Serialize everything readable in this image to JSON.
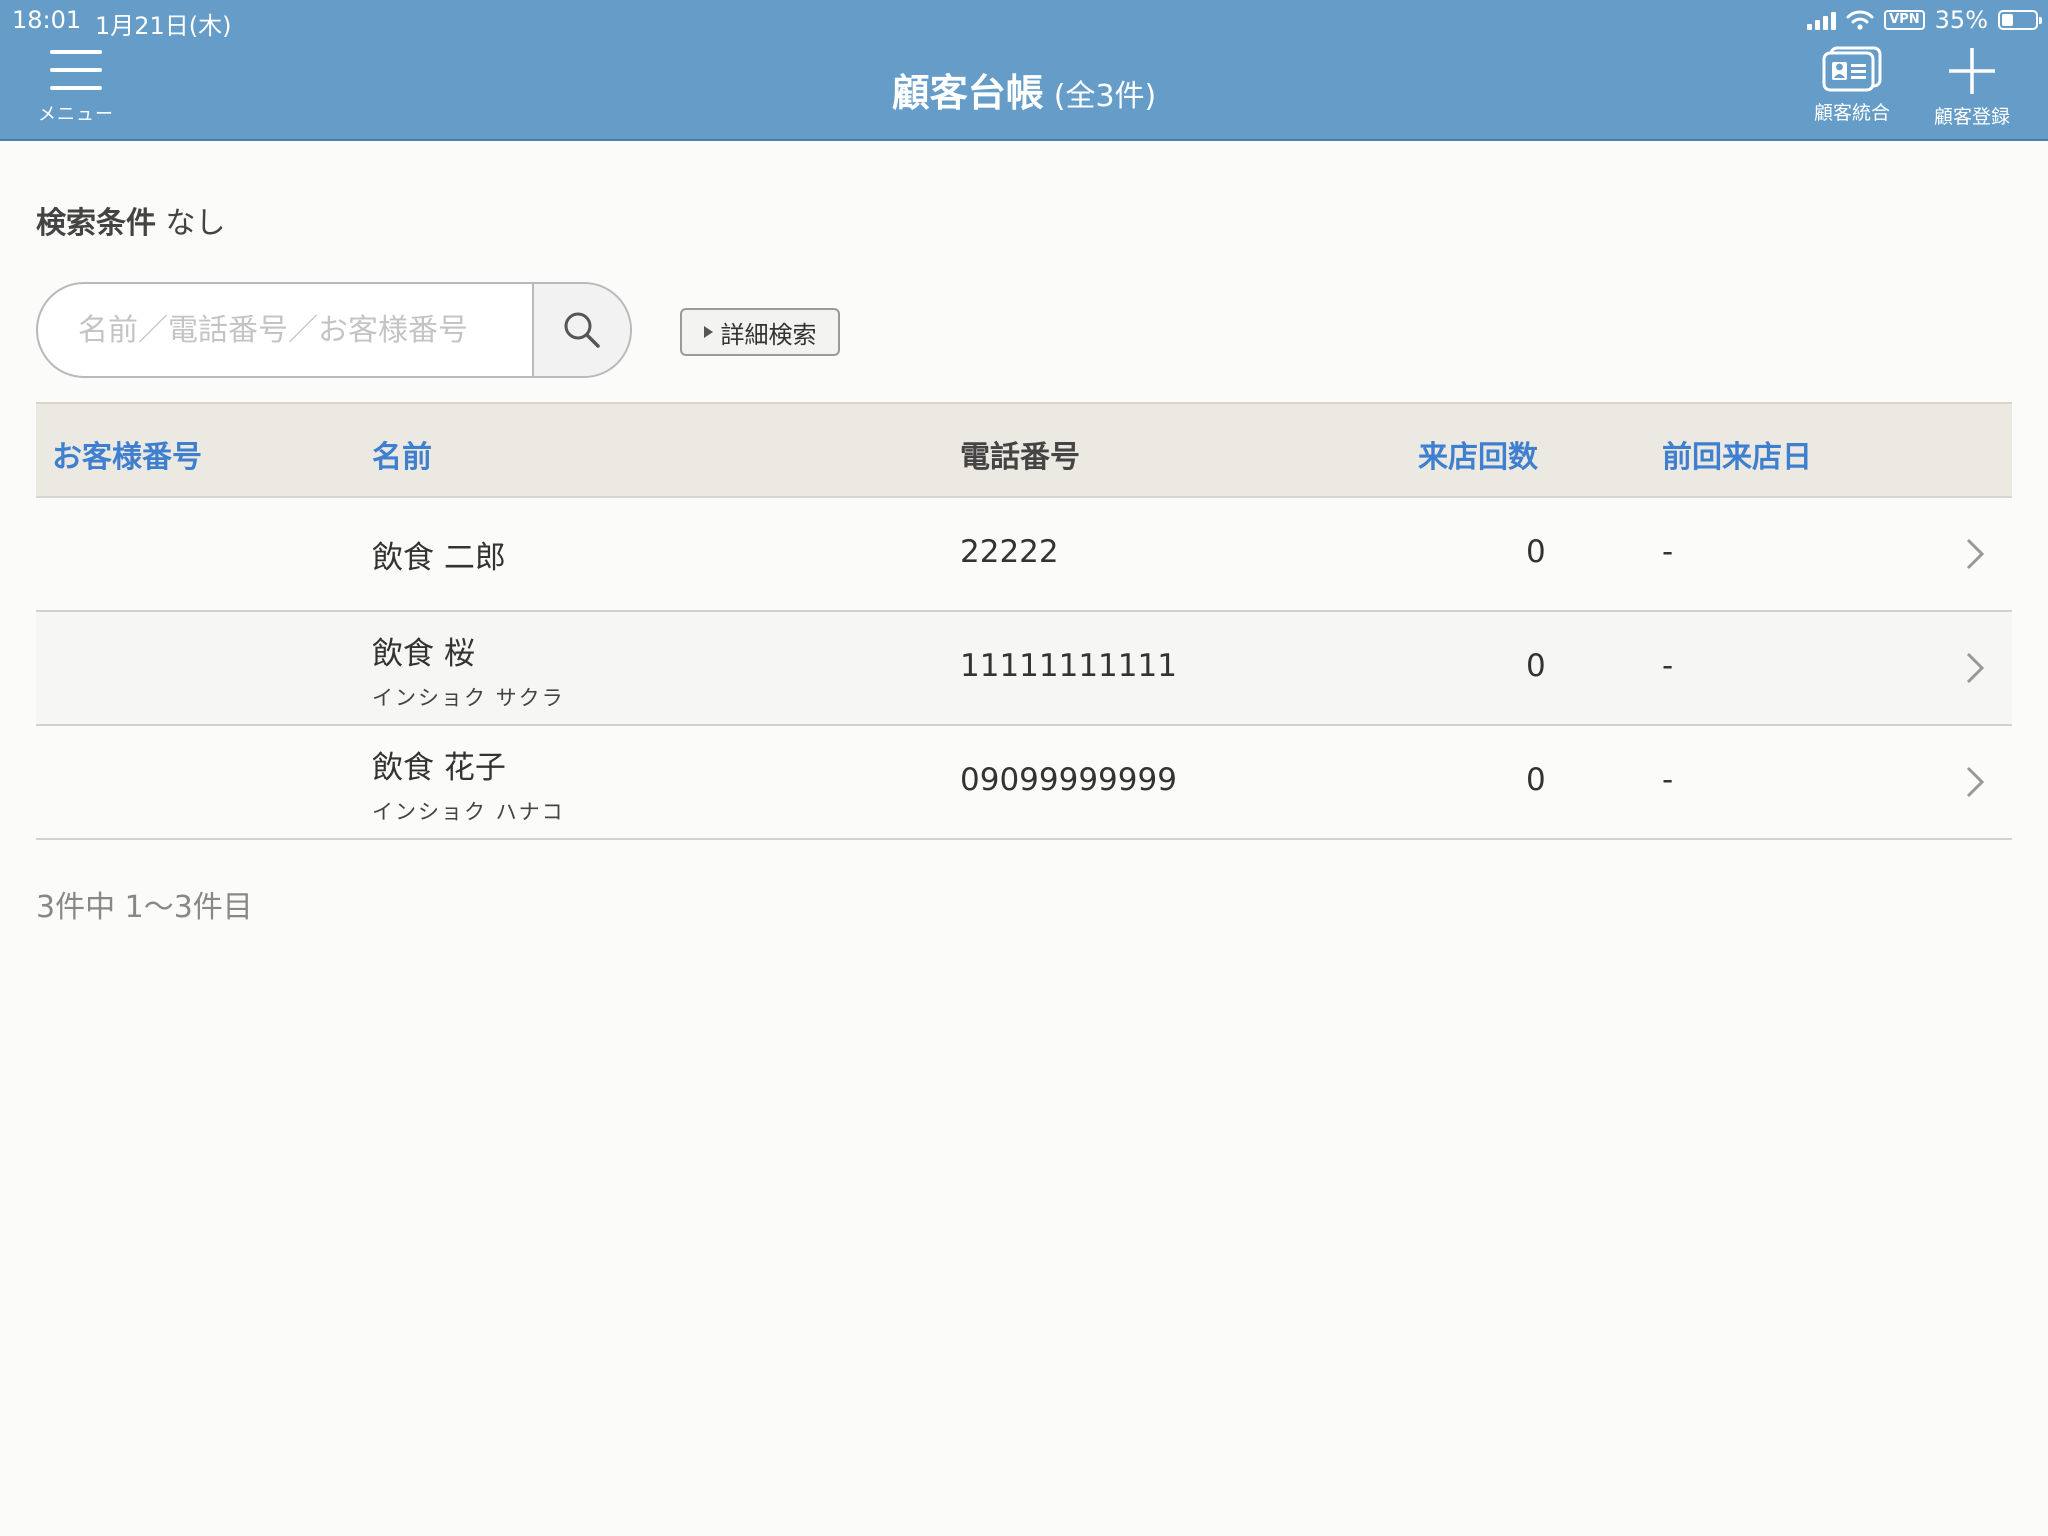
{
  "status_bar": {
    "time": "18:01",
    "date": "1月21日(木)",
    "vpn": "VPN",
    "battery": "35%",
    "battery_level": 0.35
  },
  "header": {
    "menu_label": "メニュー",
    "title": "顧客台帳",
    "count": "(全3件)",
    "merge_label": "顧客統合",
    "register_label": "顧客登録",
    "bg_color": "#659dc8"
  },
  "search": {
    "condition_label": "検索条件",
    "condition_value": "なし",
    "placeholder": "名前／電話番号／お客様番号",
    "value": "",
    "advanced_label": "詳細検索"
  },
  "table": {
    "columns": [
      "お客様番号",
      "名前",
      "電話番号",
      "来店回数",
      "前回来店日"
    ],
    "rows": [
      {
        "customer_no": "",
        "name": "飲食 二郎",
        "kana": "",
        "phone": "22222",
        "visits": "0",
        "last_visit": "-"
      },
      {
        "customer_no": "",
        "name": "飲食 桜",
        "kana": "インショク サクラ",
        "phone": "11111111111",
        "visits": "0",
        "last_visit": "-"
      },
      {
        "customer_no": "",
        "name": "飲食 花子",
        "kana": "インショク ハナコ",
        "phone": "09099999999",
        "visits": "0",
        "last_visit": "-"
      }
    ]
  },
  "pagination": {
    "summary": "3件中 1〜3件目"
  },
  "colors": {
    "accent": "#3f7fcf",
    "header_row": "#ece9e2"
  }
}
